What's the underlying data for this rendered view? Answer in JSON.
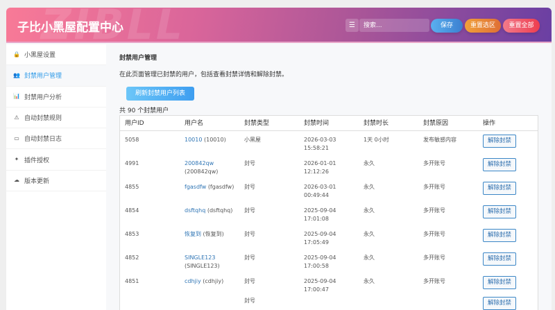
{
  "header": {
    "title": "子比小黑屋配置中心",
    "watermark": "ZIBLL",
    "search_placeholder": "搜索...",
    "save": "保存",
    "reset_section": "重置选区",
    "reset_all": "重置全部"
  },
  "sidebar": {
    "items": [
      {
        "label": "小黑屋设置",
        "icon": "lock-icon",
        "glyph": "🔒"
      },
      {
        "label": "封禁用户管理",
        "icon": "users-icon",
        "glyph": "👥"
      },
      {
        "label": "封禁用户分析",
        "icon": "bar-chart-icon",
        "glyph": "📊"
      },
      {
        "label": "自动封禁规则",
        "icon": "warning-icon",
        "glyph": "⚠"
      },
      {
        "label": "自动封禁日志",
        "icon": "log-icon",
        "glyph": "▭"
      },
      {
        "label": "插件授权",
        "icon": "plugin-icon",
        "glyph": "✦"
      },
      {
        "label": "版本更新",
        "icon": "cloud-icon",
        "glyph": "☁"
      }
    ],
    "active": 1
  },
  "main": {
    "title": "封禁用户管理",
    "description": "在此页面管理已封禁的用户，包括查看封禁详情和解除封禁。",
    "refresh_button": "刷新封禁用户列表",
    "count_text": "共 90 个封禁用户",
    "columns": [
      "用户ID",
      "用户名",
      "封禁类型",
      "封禁时间",
      "封禁时长",
      "封禁原因",
      "操作"
    ],
    "unban_label": "解除封禁",
    "rows": [
      {
        "id": "5058",
        "name": "10010",
        "display": "(10010)",
        "type": "小黑屋",
        "date": "2026-03-03",
        "time": "15:58:21",
        "duration": "1天 0小时",
        "reason": "发布敏感内容"
      },
      {
        "id": "4991",
        "name": "200842qw",
        "display": "(200842qw)",
        "type": "封号",
        "date": "2026-01-01",
        "time": "12:12:26",
        "duration": "永久",
        "reason": "多开账号"
      },
      {
        "id": "4855",
        "name": "fgasdfw",
        "display": "(fgasdfw)",
        "type": "封号",
        "date": "2026-03-01",
        "time": "00:49:44",
        "duration": "永久",
        "reason": "多开账号"
      },
      {
        "id": "4854",
        "name": "dsftqhq",
        "display": "(dsftqhq)",
        "type": "封号",
        "date": "2025-09-04",
        "time": "17:01:08",
        "duration": "永久",
        "reason": "多开账号"
      },
      {
        "id": "4853",
        "name": "恢复到",
        "display": "(恢复到)",
        "type": "封号",
        "date": "2025-09-04",
        "time": "17:05:49",
        "duration": "永久",
        "reason": "多开账号"
      },
      {
        "id": "4852",
        "name": "SINGLE123",
        "display": "(SINGLE123)",
        "type": "封号",
        "date": "2025-09-04",
        "time": "17:00:58",
        "duration": "永久",
        "reason": "多开账号"
      },
      {
        "id": "4851",
        "name": "cdhjiy",
        "display": "(cdhjiy)",
        "type": "封号",
        "date": "2025-09-04",
        "time": "17:00:47",
        "duration": "永久",
        "reason": "多开账号"
      },
      {
        "type": "封号"
      }
    ]
  }
}
